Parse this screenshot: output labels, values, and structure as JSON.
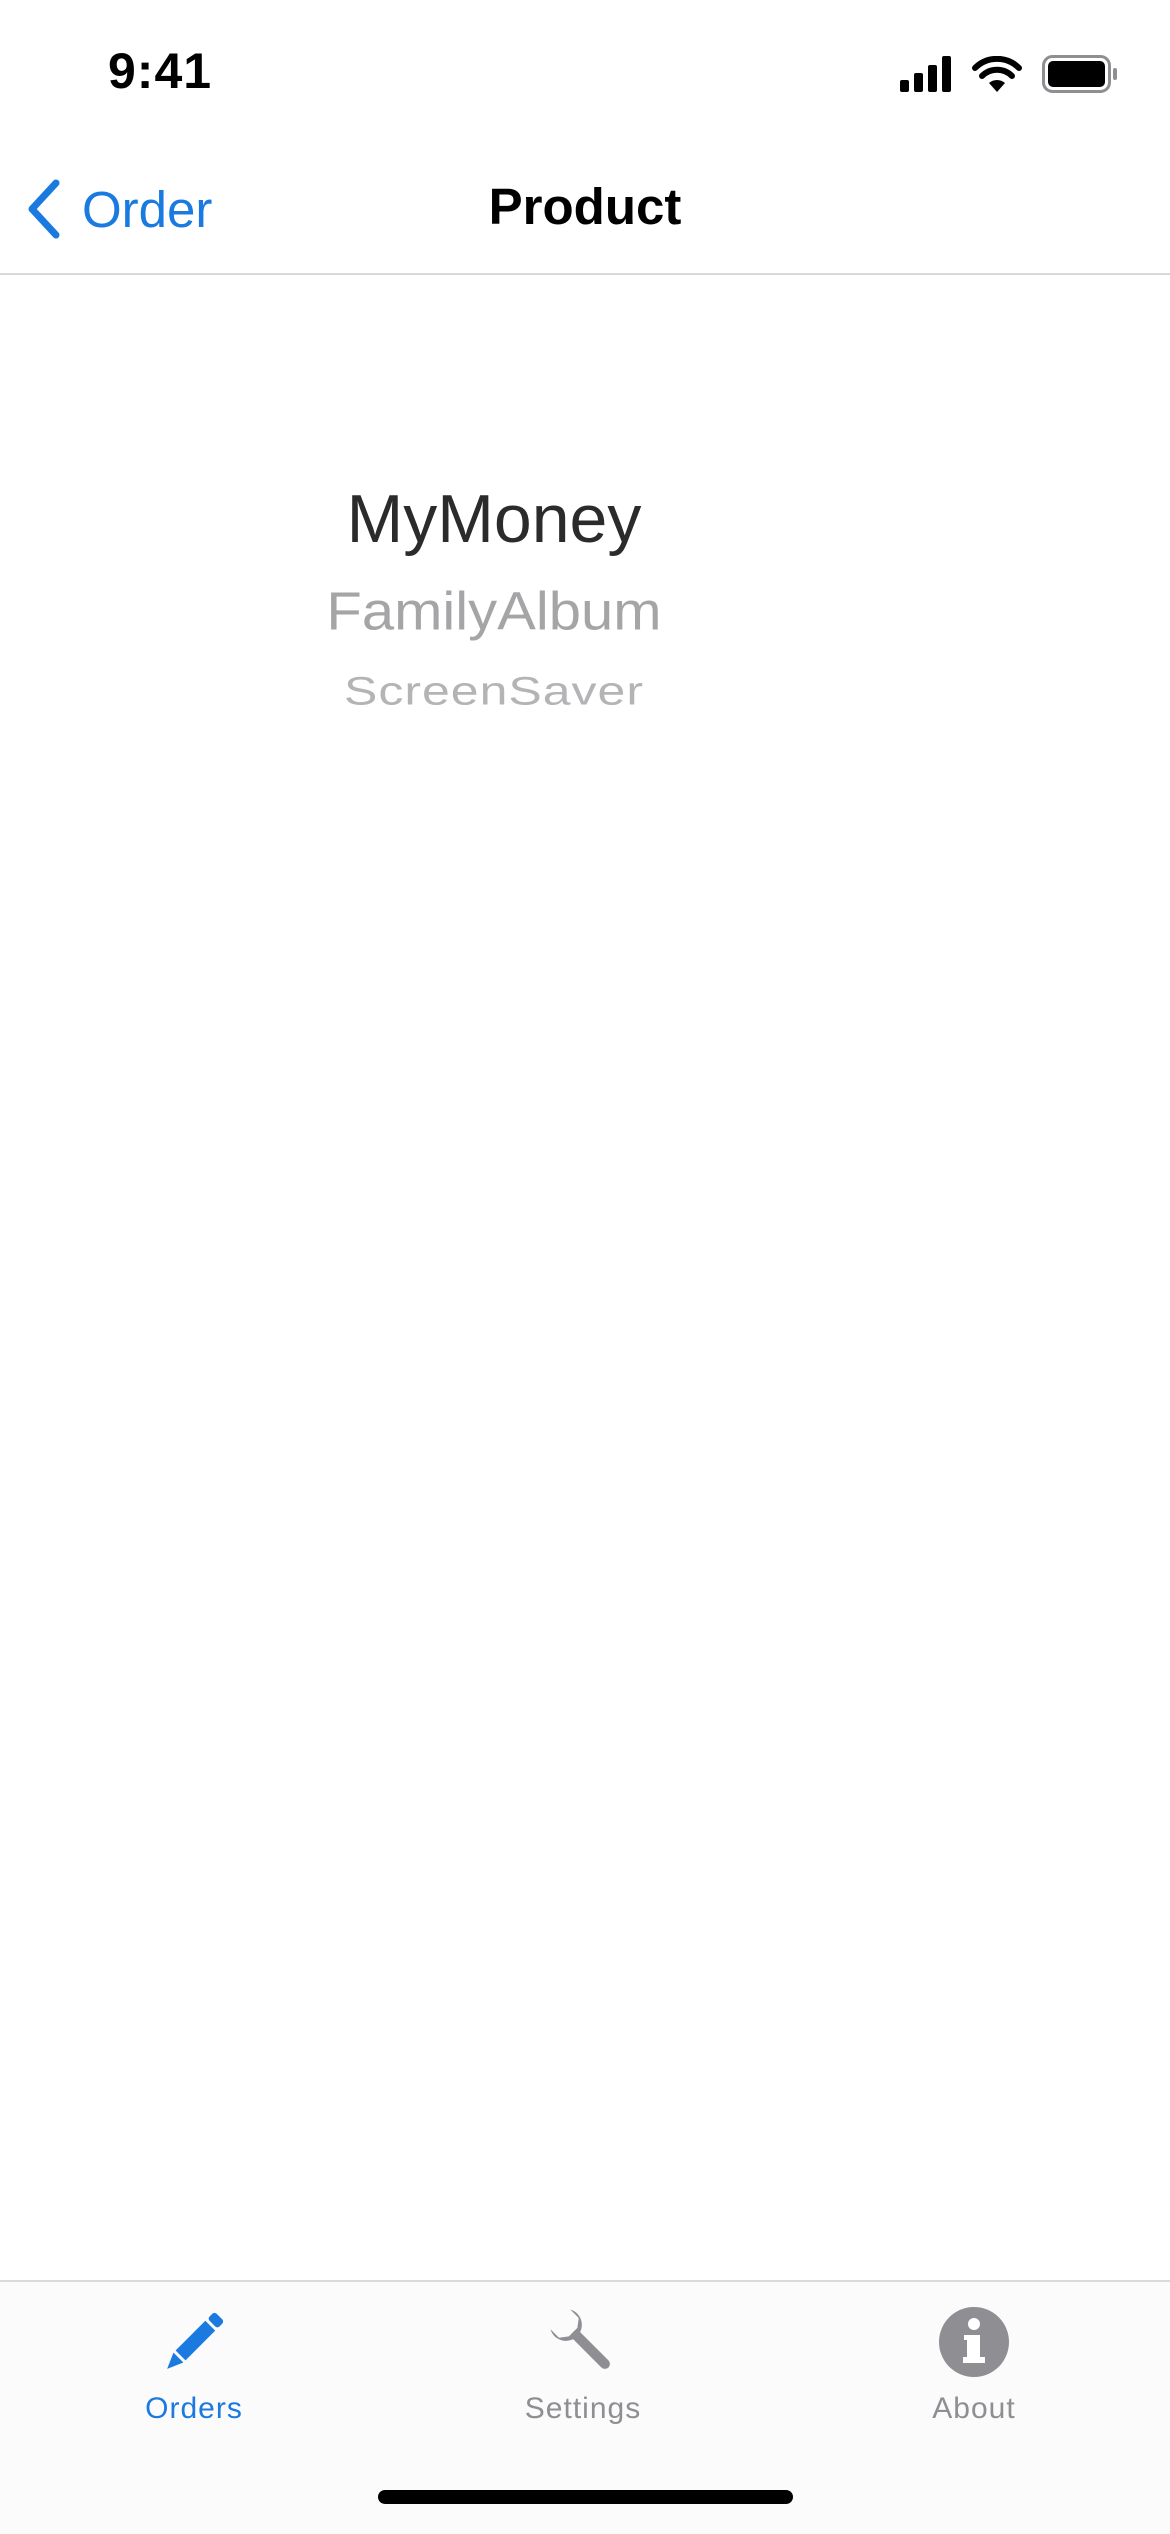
{
  "status_bar": {
    "time": "9:41",
    "icons": [
      "cellular-signal-icon",
      "wifi-icon",
      "battery-icon"
    ]
  },
  "nav": {
    "back_label": "Order",
    "title": "Product",
    "back_icon": "chevron-left-icon"
  },
  "picker": {
    "items": [
      "MyMoney",
      "FamilyAlbum",
      "ScreenSaver"
    ],
    "selected": "MyMoney"
  },
  "tabs": [
    {
      "label": "Orders",
      "icon": "pencil-icon",
      "active": true
    },
    {
      "label": "Settings",
      "icon": "wrench-icon",
      "active": false
    },
    {
      "label": "About",
      "icon": "info-icon",
      "active": false
    }
  ],
  "colors": {
    "accent": "#1a7ae0",
    "inactive": "#8e8e93",
    "picker_selected": "#2b2b2b",
    "picker_unselected": "#a5a5a8"
  }
}
